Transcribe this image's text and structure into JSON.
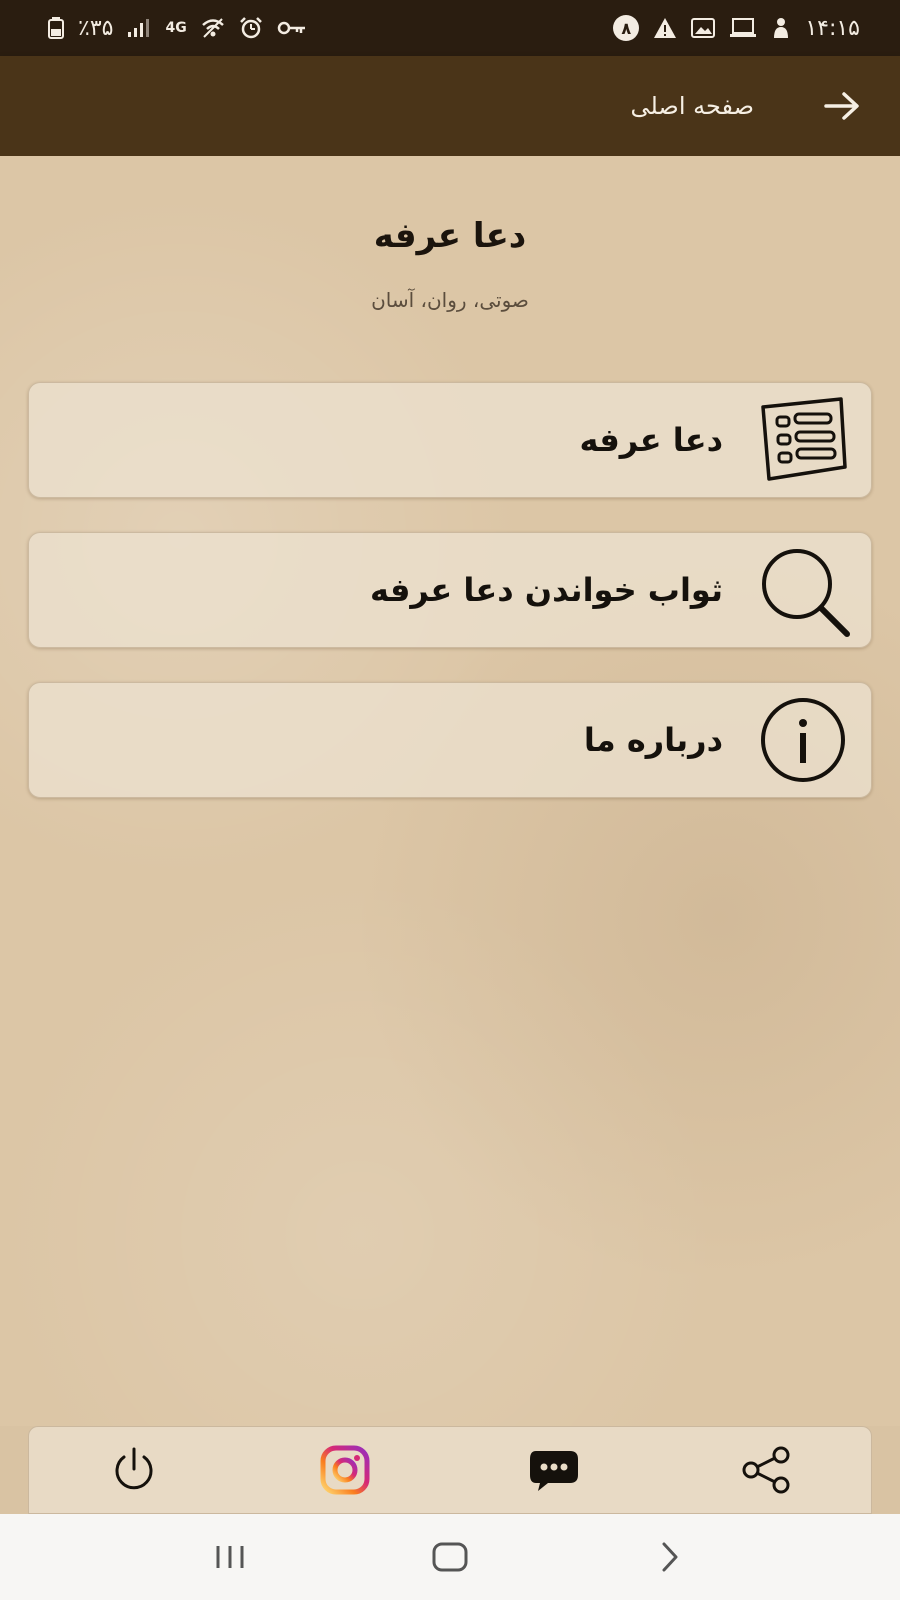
{
  "status_bar": {
    "time": "۱۴:۱۵",
    "notification_count": "۸",
    "battery_percent": "٪۳۵",
    "network": "4G"
  },
  "app_bar": {
    "title": "صفحه اصلی",
    "back_icon": "arrow-right-icon"
  },
  "header": {
    "title": "دعا عرفه",
    "subtitle": "صوتی، روان، آسان"
  },
  "menu": {
    "items": [
      {
        "label": "دعا عرفه",
        "icon": "list-document-icon"
      },
      {
        "label": "ثواب خواندن دعا عرفه",
        "icon": "search-icon"
      },
      {
        "label": "درباره ما",
        "icon": "info-icon"
      }
    ]
  },
  "bottom_bar": {
    "items": [
      {
        "icon": "share-icon"
      },
      {
        "icon": "chat-icon"
      },
      {
        "icon": "instagram-icon",
        "color": "#d62976"
      },
      {
        "icon": "power-icon"
      }
    ]
  },
  "nav_bar": {
    "items": [
      {
        "icon": "back-chevron-icon"
      },
      {
        "icon": "home-icon"
      },
      {
        "icon": "recents-icon"
      }
    ]
  }
}
